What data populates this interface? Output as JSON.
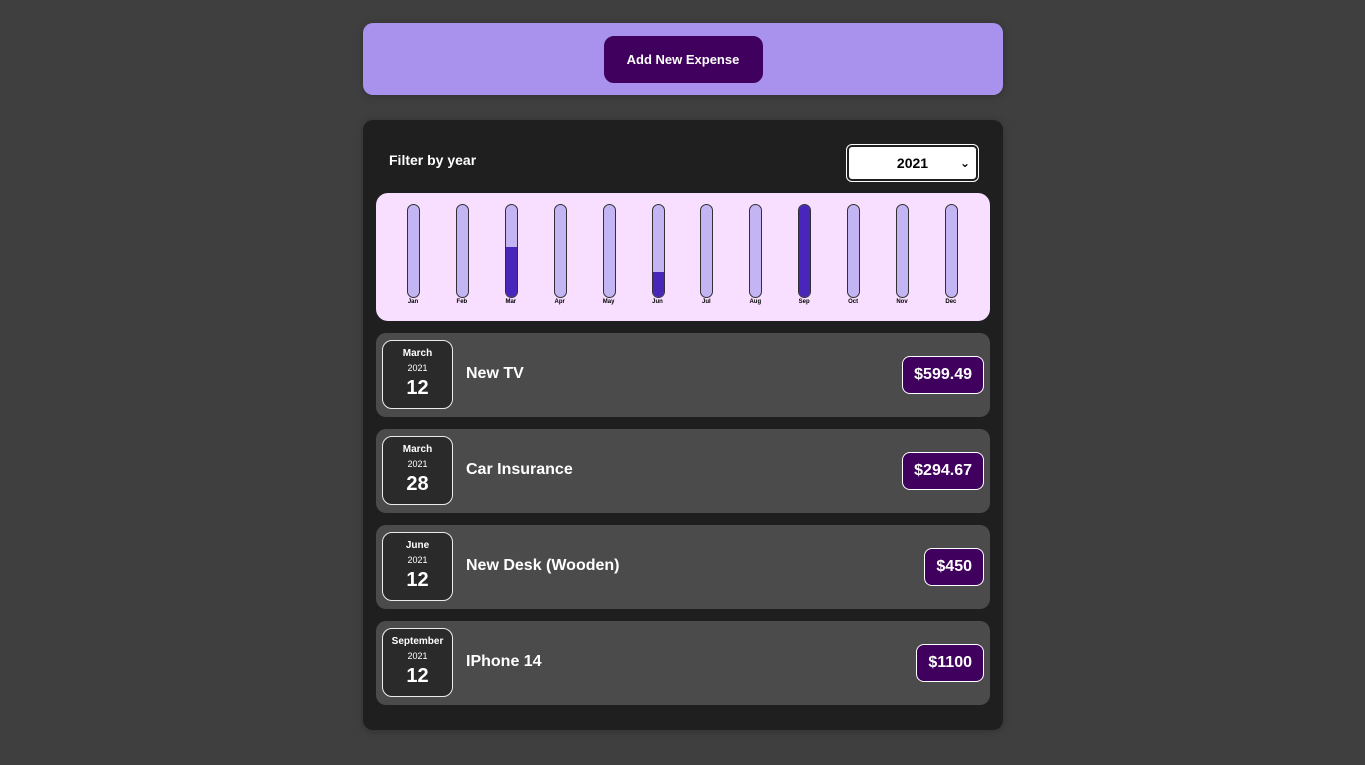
{
  "new_expense": {
    "button_label": "Add New Expense"
  },
  "filter": {
    "label": "Filter by year",
    "selected_year": "2021",
    "chevron": "⌄"
  },
  "chart_data": {
    "type": "bar",
    "categories": [
      "Jan",
      "Feb",
      "Mar",
      "Apr",
      "May",
      "Jun",
      "Jul",
      "Aug",
      "Sep",
      "Oct",
      "Nov",
      "Dec"
    ],
    "values": [
      0,
      0,
      599.49,
      0,
      0,
      294.67,
      0,
      0,
      1100,
      0,
      0,
      0
    ],
    "ylim": [
      0,
      1100
    ],
    "track_color": "#c3b4f3",
    "fill_color": "#4826b9"
  },
  "expenses": [
    {
      "month": "March",
      "year": "2021",
      "day": "12",
      "title": "New TV",
      "amount": "$599.49"
    },
    {
      "month": "March",
      "year": "2021",
      "day": "28",
      "title": "Car Insurance",
      "amount": "$294.67"
    },
    {
      "month": "June",
      "year": "2021",
      "day": "12",
      "title": "New Desk (Wooden)",
      "amount": "$450"
    },
    {
      "month": "September",
      "year": "2021",
      "day": "12",
      "title": "IPhone 14",
      "amount": "$1100"
    }
  ],
  "colors": {
    "background": "#3f3f3f",
    "header_panel": "#a892ee",
    "accent": "#40005d",
    "card": "#1f1f1f",
    "item": "#4b4b4b",
    "chart_bg": "#f8dfff"
  }
}
